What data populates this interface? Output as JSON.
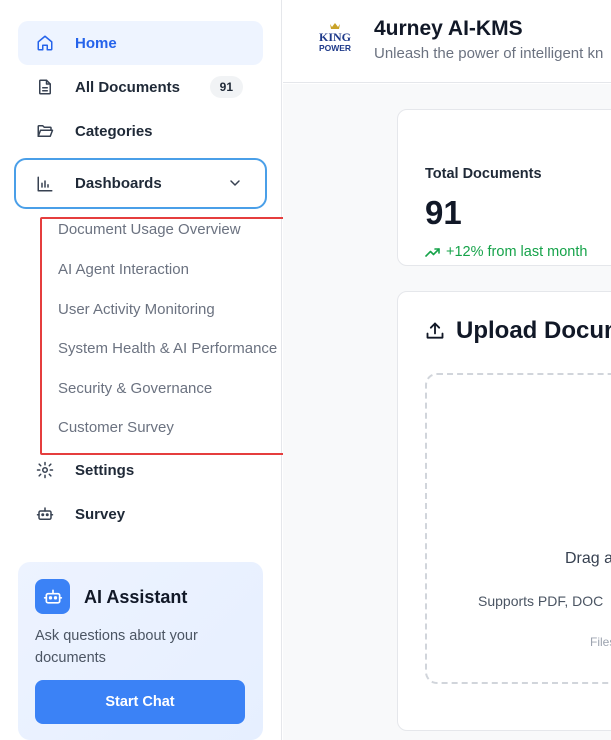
{
  "sidebar": {
    "items": [
      {
        "label": "Home",
        "icon": "home-icon"
      },
      {
        "label": "All Documents",
        "icon": "document-icon",
        "badge": "91"
      },
      {
        "label": "Categories",
        "icon": "folder-open-icon"
      },
      {
        "label": "Dashboards",
        "icon": "bar-chart-icon",
        "expanded": true
      },
      {
        "label": "Settings",
        "icon": "gear-icon"
      },
      {
        "label": "Survey",
        "icon": "bot-icon"
      }
    ],
    "dashboard_subitems": [
      "Document Usage Overview",
      "AI Agent Interaction",
      "User Activity Monitoring",
      "System Health & AI Performance",
      "Security & Governance",
      "Customer Survey"
    ],
    "assistant": {
      "title": "AI Assistant",
      "description": "Ask questions about your documents",
      "button": "Start Chat"
    }
  },
  "header": {
    "logo_top": "KING",
    "logo_bottom": "POWER",
    "title": "4urney AI-KMS",
    "subtitle": "Unleash the power of intelligent kn"
  },
  "main": {
    "stat": {
      "label": "Total Documents",
      "value": "91",
      "change": "+12% from last month"
    },
    "upload": {
      "title": "Upload Docum",
      "drop_text": "Drag a",
      "support_text": "Supports PDF, DOC",
      "files_text": "Files"
    }
  },
  "colors": {
    "accent": "#2563eb",
    "button": "#3b82f6",
    "active_bg": "#eef4ff",
    "highlight_border": "#e53e3e",
    "focus_border": "#4a9fe8",
    "positive": "#16a34a"
  }
}
